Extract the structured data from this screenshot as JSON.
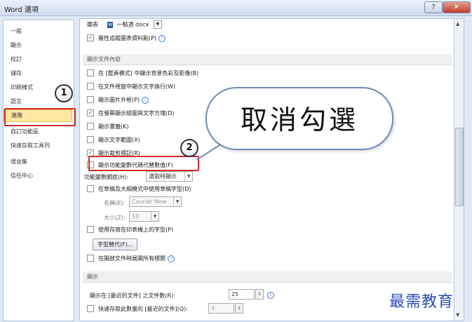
{
  "window": {
    "title": "Word 選項",
    "help_label": "?",
    "close_label": "✕"
  },
  "sidebar": {
    "items": [
      {
        "label": "一般"
      },
      {
        "label": "顯示"
      },
      {
        "label": "校訂"
      },
      {
        "label": "儲存"
      },
      {
        "label": "印刷樣式"
      },
      {
        "label": "語言"
      },
      {
        "label": "進階",
        "selected": true
      },
      {
        "label": "自訂功能區"
      },
      {
        "label": "快速存取工具列"
      },
      {
        "label": "增益集"
      },
      {
        "label": "信任中心"
      }
    ]
  },
  "content": {
    "top_row": {
      "label": "圖表",
      "doc_value": "一點透.docx"
    },
    "chart_property": {
      "label": "屬性追蹤圖表資料點(P)",
      "checked": true
    },
    "section_display_content": {
      "header": "顯示文件內容"
    },
    "options": [
      {
        "label": "在 [整頁模式] 中顯示背景色彩及影像(B)",
        "checked": false
      },
      {
        "label": "在文件視窗中顯示文字換行(W)",
        "checked": false
      },
      {
        "label": "顯示圖片外框(P)",
        "checked": false,
        "info": true
      },
      {
        "label": "在螢幕顯示繪圖與文字方塊(D)",
        "checked": true
      },
      {
        "label": "顯示書籤(K)",
        "checked": false
      },
      {
        "label": "顯示文字範圍(X)",
        "checked": false
      },
      {
        "label": "顯示裁剪標記(R)",
        "checked": true
      },
      {
        "label": "顯示功能變數代碼代替數值(F)",
        "checked": false
      }
    ],
    "field_shading": {
      "label": "功能變數網底(H):",
      "value": "選取時顯示"
    },
    "draft_font": {
      "label": "在草稿及大綱模式中使用草稿字型(D)",
      "checked": false
    },
    "font_name": {
      "label": "名稱(E):",
      "value": "Courier New"
    },
    "font_size": {
      "label": "大小(Z):",
      "value": "10"
    },
    "printer_fonts": {
      "label": "使用存放在印表機上的字型(P)",
      "checked": false
    },
    "font_subst_button": "字型替代(F)...",
    "expand_headings": {
      "label": "在開啟文件時展開所有標題",
      "checked": false
    },
    "section_display": {
      "header": "顯示"
    },
    "recent_docs": {
      "label": "顯示在 [最近的文件] 之文件數(R):",
      "value": "25"
    },
    "quick_access": {
      "label": "快速存取此數量的 [最近的文件](Q):",
      "value": "4",
      "checked": false
    }
  },
  "annotations": {
    "bubble_text": "取消勾選",
    "circle_1": "1",
    "circle_2": "2",
    "watermark": "最需教育"
  },
  "colors": {
    "highlight_red": "#d42a2a",
    "selected_nav": "#ffe7a1"
  }
}
